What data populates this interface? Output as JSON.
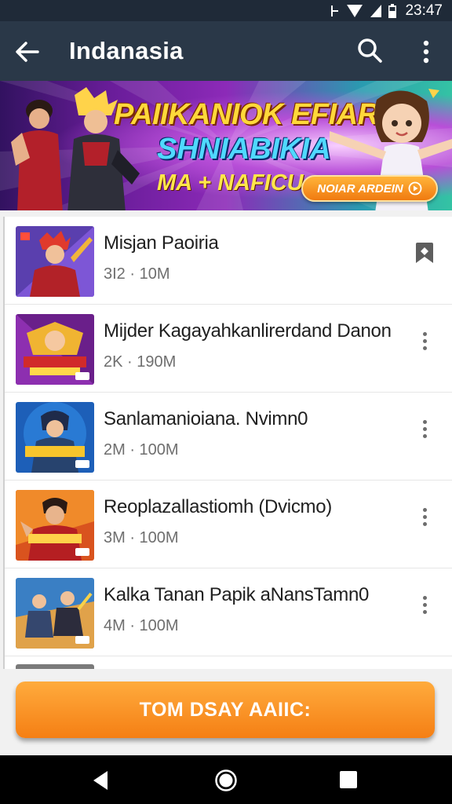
{
  "status_bar": {
    "time": "23:47"
  },
  "app_bar": {
    "title": "Indanasia"
  },
  "banner": {
    "title_line1": "PAIIKANIOK EFIAR",
    "title_line2": "SHNIABIKIA",
    "subtitle": "MA + NAFICU",
    "cta_label": "NOIAR ARDEIN"
  },
  "list": {
    "items": [
      {
        "title": "Misjan Paoiria",
        "meta": "3I2 · 10M",
        "action": "bookmark-icon"
      },
      {
        "title": "Mijder Kagayahkanlirerdand Danon",
        "meta": "2K · 190M",
        "action": "more-vert-icon"
      },
      {
        "title": "Sanlamanioiana. Nvimn0",
        "meta": "2M · 100M",
        "action": "more-vert-icon"
      },
      {
        "title": "Reoplazallastiomh (Dvicmo)",
        "meta": "3M · 100M",
        "action": "more-vert-icon"
      },
      {
        "title": "Kalka Tanan Papik aNansTamn0",
        "meta": "4M · 100M",
        "action": "more-vert-icon"
      }
    ]
  },
  "cta": {
    "label": "TOM DSAY AAIIC:"
  },
  "colors": {
    "app_bar": "#2a3848",
    "status_bar": "#1f2a38",
    "accent_orange": "#f57f14"
  }
}
